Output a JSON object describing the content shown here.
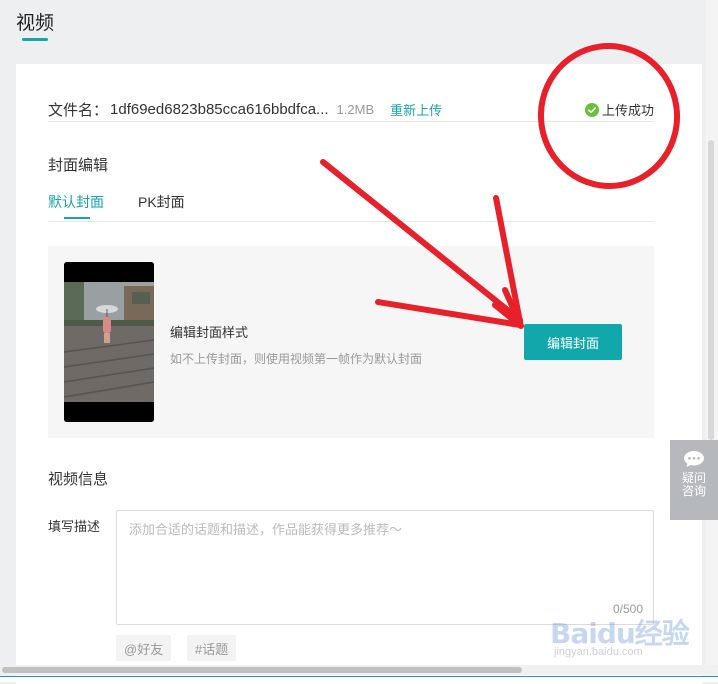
{
  "page": {
    "tab_title": "视频"
  },
  "file": {
    "label": "文件名：",
    "name": "1df69ed6823b85cca616bbdfca...",
    "size": "1.2MB",
    "reupload": "重新上传",
    "status": "上传成功"
  },
  "cover": {
    "section_title": "封面编辑",
    "tabs": [
      "默认封面",
      "PK封面"
    ],
    "style_label": "编辑封面样式",
    "hint": "如不上传封面，则使用视频第一帧作为默认封面",
    "edit_button": "编辑封面"
  },
  "video_info": {
    "section_title": "视频信息",
    "desc_label": "填写描述",
    "desc_placeholder": "添加合适的话题和描述，作品能获得更多推荐～",
    "desc_counter": "0/500",
    "chips": [
      "@好友",
      "#话题"
    ]
  },
  "help": {
    "label": "疑问咨询"
  },
  "watermark": {
    "brand": "Baidu经验",
    "url": "jingyan.baidu.com"
  },
  "colors": {
    "accent": "#11a7ab",
    "annotation": "#e8202a",
    "success": "#67c23a"
  }
}
